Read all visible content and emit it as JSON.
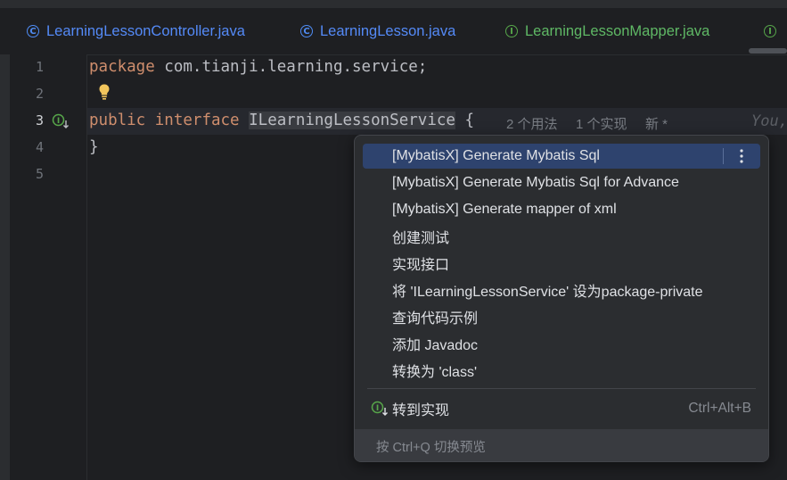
{
  "tabs": [
    {
      "label": "LearningLessonController.java",
      "kind": "class",
      "icon": "class-icon"
    },
    {
      "label": "LearningLesson.java",
      "kind": "class",
      "icon": "class-icon"
    },
    {
      "label": "LearningLessonMapper.java",
      "kind": "interface",
      "icon": "interface-icon"
    }
  ],
  "editor": {
    "line_numbers": [
      "1",
      "2",
      "3",
      "4",
      "5"
    ],
    "active_line": "3",
    "line1": {
      "kw": "package",
      "rest": " com.tianji.learning.service;"
    },
    "line3": {
      "kw1": "public",
      "kw2": "interface",
      "name": "ILearningLessonService",
      "brace": " {"
    },
    "line4": "}",
    "inlay_hints": {
      "usages": "2 个用法",
      "impls": "1 个实现",
      "new": "新 *"
    },
    "author_hint": "You,"
  },
  "popup": {
    "items": [
      {
        "label": "[MybatisX] Generate Mybatis Sql",
        "selected": true
      },
      {
        "label": "[MybatisX] Generate Mybatis Sql for Advance"
      },
      {
        "label": "[MybatisX] Generate mapper of xml"
      },
      {
        "label": "创建测试"
      },
      {
        "label": "实现接口"
      },
      {
        "label": "将 'ILearningLessonService' 设为package-private"
      },
      {
        "label": "查询代码示例"
      },
      {
        "label": "添加 Javadoc"
      },
      {
        "label": "转换为 'class'"
      }
    ],
    "goto_impl": {
      "label": "转到实现",
      "shortcut": "Ctrl+Alt+B",
      "icon": "implementation-icon"
    },
    "footer": "按 Ctrl+Q 切换预览"
  },
  "colors": {
    "keyword": "#cf8e6d",
    "selection": "#2e436e",
    "class_icon": "#4f8cf5",
    "interface_icon": "#57a64a"
  }
}
